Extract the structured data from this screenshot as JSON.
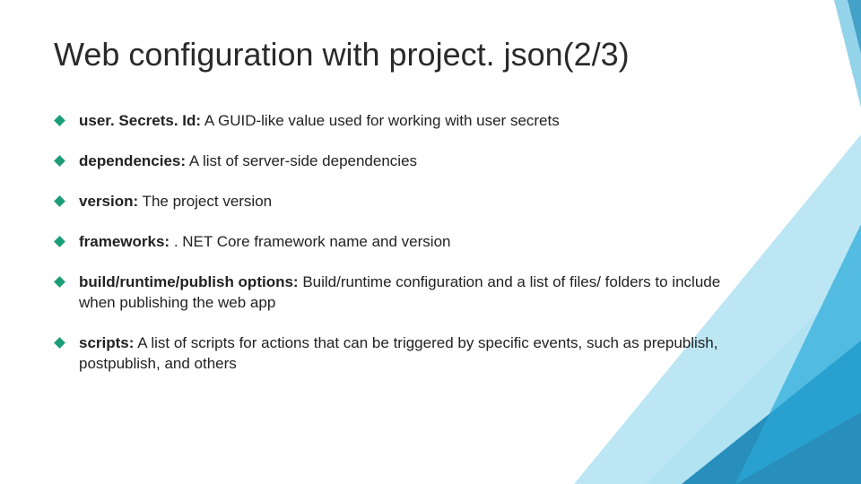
{
  "title": "Web configuration with project. json(2/3)",
  "bullets": [
    {
      "label": "user. Secrets. Id:",
      "desc": " A GUID-like value used for working with user secrets"
    },
    {
      "label": "dependencies:",
      "desc": " A list of server-side dependencies"
    },
    {
      "label": "version:",
      "desc": " The project version"
    },
    {
      "label": "frameworks:",
      "desc": " . NET Core framework name and version"
    },
    {
      "label": "build/runtime/publish options:",
      "desc": " Build/runtime configuration and a list of files/ folders to include when publishing the web app"
    },
    {
      "label": "scripts:",
      "desc": " A list of scripts for actions that can be triggered by specific events, such as prepublish, postpublish, and others"
    }
  ],
  "theme": {
    "accent": "#1b9e77",
    "shape_light": "#bfe9f5",
    "shape_mid": "#2aa9d8",
    "shape_dark": "#0f7fb0"
  }
}
